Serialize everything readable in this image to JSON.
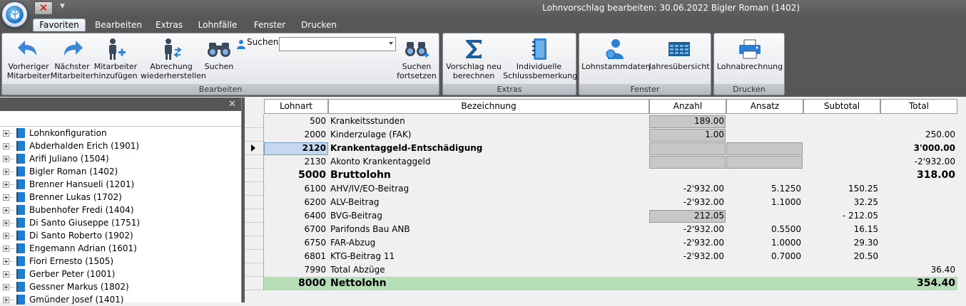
{
  "window": {
    "title": "Lohnvorschlag bearbeiten: 30.06.2022 Bigler Roman (1402)"
  },
  "tabs": [
    "Favoriten",
    "Bearbeiten",
    "Extras",
    "Lohnfälle",
    "Fenster",
    "Drucken"
  ],
  "ribbon": {
    "bearbeiten": {
      "label": "Bearbeiten",
      "prev": [
        "Vorheriger",
        "Mitarbeiter"
      ],
      "next": [
        "Nächster",
        "Mitarbeiter"
      ],
      "add": [
        "Mitarbeiter",
        "hinzufügen"
      ],
      "restore": [
        "Abrechung",
        "wiederherstellen"
      ],
      "search": "Suchen",
      "search_label": "Suchen",
      "search_value": "",
      "continue": [
        "Suchen",
        "fortsetzen"
      ]
    },
    "extras": {
      "label": "Extras",
      "recalc": [
        "Vorschlag neu",
        "berechnen"
      ],
      "remark": [
        "Individuelle",
        "Schlussbemerkung"
      ]
    },
    "fenster": {
      "label": "Fenster",
      "stamm": "Lohnstammdaten",
      "jahr": "Jahresübersicht"
    },
    "drucken": {
      "label": "Drucken",
      "lohn": "Lohnabrechnung"
    }
  },
  "tree": [
    "Lohnkonfiguration",
    "Abderhalden Erich (1901)",
    "Arifi Juliano (1504)",
    "Bigler Roman (1402)",
    "Brenner Hansueli (1201)",
    "Brenner Lukas (1702)",
    "Bubenhofer Fredi (1404)",
    "Di Santo Giuseppe (1751)",
    "Di Santo Roberto (1902)",
    "Engemann Adrian (1601)",
    "Fiori Ernesto (1505)",
    "Gerber Peter (1001)",
    "Gessner Markus (1802)",
    "Gmünder Josef (1401)"
  ],
  "grid": {
    "columns": [
      "Lohnart",
      "Bezeichnung",
      "Anzahl",
      "Ansatz",
      "Subtotal",
      "Total"
    ],
    "rows": [
      {
        "code": "500",
        "name": "Krankeitsstunden",
        "anzahl": "189.00",
        "ansatz": "",
        "subtotal": "",
        "total": ""
      },
      {
        "code": "2000",
        "name": "Kinderzulage (FAK)",
        "anzahl": "1.00",
        "ansatz": "",
        "subtotal": "",
        "total": "250.00"
      },
      {
        "code": "2120",
        "name": "Krankentaggeld-Entschädigung",
        "anzahl": "",
        "ansatz": "",
        "subtotal": "",
        "total": "3'000.00"
      },
      {
        "code": "2130",
        "name": "Akonto Krankentaggeld",
        "anzahl": "",
        "ansatz": "",
        "subtotal": "",
        "total": "-2'932.00"
      },
      {
        "code": "5000",
        "name": "Bruttolohn",
        "anzahl": "",
        "ansatz": "",
        "subtotal": "",
        "total": "318.00"
      },
      {
        "code": "6100",
        "name": "AHV/IV/EO-Beitrag",
        "anzahl": "-2'932.00",
        "ansatz": "5.1250",
        "subtotal": "150.25",
        "total": ""
      },
      {
        "code": "6200",
        "name": "ALV-Beitrag",
        "anzahl": "-2'932.00",
        "ansatz": "1.1000",
        "subtotal": "32.25",
        "total": ""
      },
      {
        "code": "6400",
        "name": "BVG-Beitrag",
        "anzahl": "212.05",
        "ansatz": "",
        "subtotal": "- 212.05",
        "total": ""
      },
      {
        "code": "6700",
        "name": "Parifonds Bau ANB",
        "anzahl": "-2'932.00",
        "ansatz": "0.5500",
        "subtotal": "16.15",
        "total": ""
      },
      {
        "code": "6750",
        "name": "FAR-Abzug",
        "anzahl": "-2'932.00",
        "ansatz": "1.0000",
        "subtotal": "29.30",
        "total": ""
      },
      {
        "code": "6801",
        "name": "KTG-Beitrag 11",
        "anzahl": "-2'932.00",
        "ansatz": "0.7000",
        "subtotal": "20.50",
        "total": ""
      },
      {
        "code": "7990",
        "name": "Total Abzüge",
        "anzahl": "",
        "ansatz": "",
        "subtotal": "",
        "total": "36.40"
      },
      {
        "code": "8000",
        "name": "Nettolohn",
        "anzahl": "",
        "ansatz": "",
        "subtotal": "",
        "total": "354.40"
      }
    ]
  }
}
